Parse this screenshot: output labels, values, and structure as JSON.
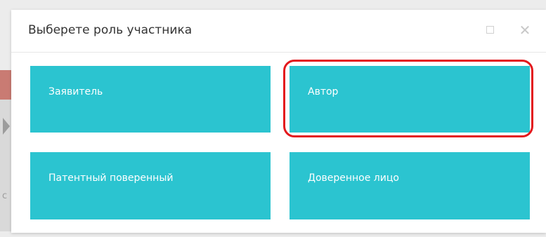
{
  "dialog": {
    "title": "Выберете роль участника",
    "maximize_icon": "square-outline-icon",
    "close_icon": "close-icon",
    "close_glyph": "✕"
  },
  "background": {
    "partial_letter": "с"
  },
  "roles": [
    {
      "label": "Заявитель"
    },
    {
      "label": "Автор",
      "highlighted": true
    },
    {
      "label": "Патентный поверенный"
    },
    {
      "label": "Доверенное лицо"
    }
  ],
  "colors": {
    "tile": "#2bc4d0",
    "highlight": "#e3191d"
  }
}
